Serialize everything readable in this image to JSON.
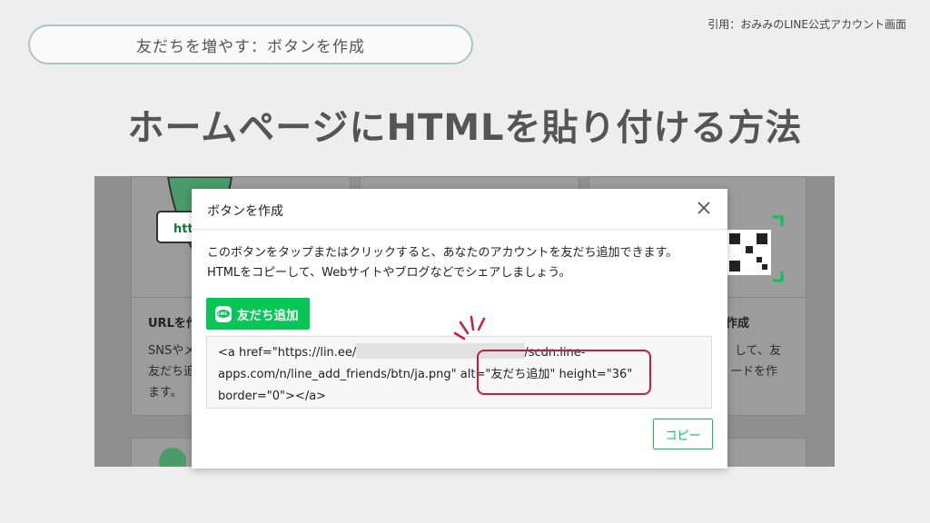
{
  "citation": "引用：おみみのLINE公式アカウント画面",
  "section_pill": "友だちを増やす：ボタンを作成",
  "headline": "ホームページにHTMLを貼り付ける方法",
  "background_page": {
    "card1_title": "URLを作",
    "card1_text_line1": "SNSやメ",
    "card1_text_line2": "友だち追",
    "card1_text_line3": "ます。",
    "card3_title": "作成",
    "card3_text_line1": "して、友",
    "card3_text_line2": "ードを作",
    "card1_badge": "htt"
  },
  "modal": {
    "title": "ボタンを作成",
    "close_icon": "close-icon",
    "description_line1": "このボタンをタップまたはクリックすると、あなたのアカウントを友だち追加できます。",
    "description_line2": "HTMLをコピーして、Webサイトやブログなどでシェアしましょう。",
    "add_friend_label": "友だち追加",
    "line_logo_text": "LINE",
    "code_line1_prefix": "<a href=\"https://lin.ee/",
    "code_line1_suffix": "/scdn.line-",
    "code_line2": "apps.com/n/line_add_friends/btn/ja.png\" alt=\"友だち追加\" height=\"36\"",
    "code_line3": "border=\"0\"></a>",
    "copy_label": "コピー"
  },
  "colors": {
    "line_green": "#06c755",
    "highlight_red": "#c91d37",
    "pill_border": "#a8c6cc"
  }
}
